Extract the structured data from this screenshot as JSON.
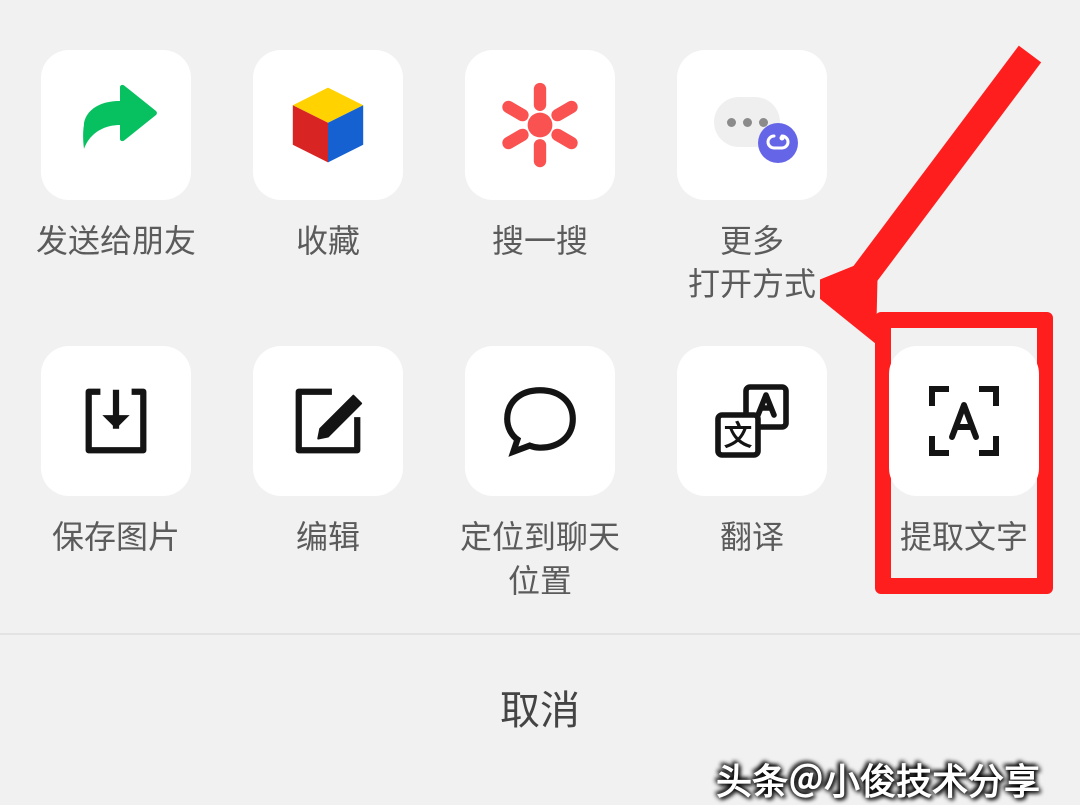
{
  "actions_row1": [
    {
      "name": "send-to-friend",
      "label": "发送给朋友",
      "icon": "share-arrow"
    },
    {
      "name": "favorite",
      "label": "收藏",
      "icon": "cube"
    },
    {
      "name": "search",
      "label": "搜一搜",
      "icon": "asterisk"
    },
    {
      "name": "more-open-with",
      "label": "更多\n打开方式",
      "icon": "more-mini"
    }
  ],
  "actions_row2": [
    {
      "name": "save-image",
      "label": "保存图片",
      "icon": "download"
    },
    {
      "name": "edit",
      "label": "编辑",
      "icon": "edit"
    },
    {
      "name": "locate-in-chat",
      "label": "定位到聊天\n位置",
      "icon": "chat-bubble"
    },
    {
      "name": "translate",
      "label": "翻译",
      "icon": "translate"
    },
    {
      "name": "extract-text",
      "label": "提取文字",
      "icon": "ocr",
      "highlight": true
    }
  ],
  "cancel_label": "取消",
  "watermark": "头条＠小俊技术分享",
  "colors": {
    "highlight": "#ff1e1e",
    "share_green": "#07c160"
  }
}
